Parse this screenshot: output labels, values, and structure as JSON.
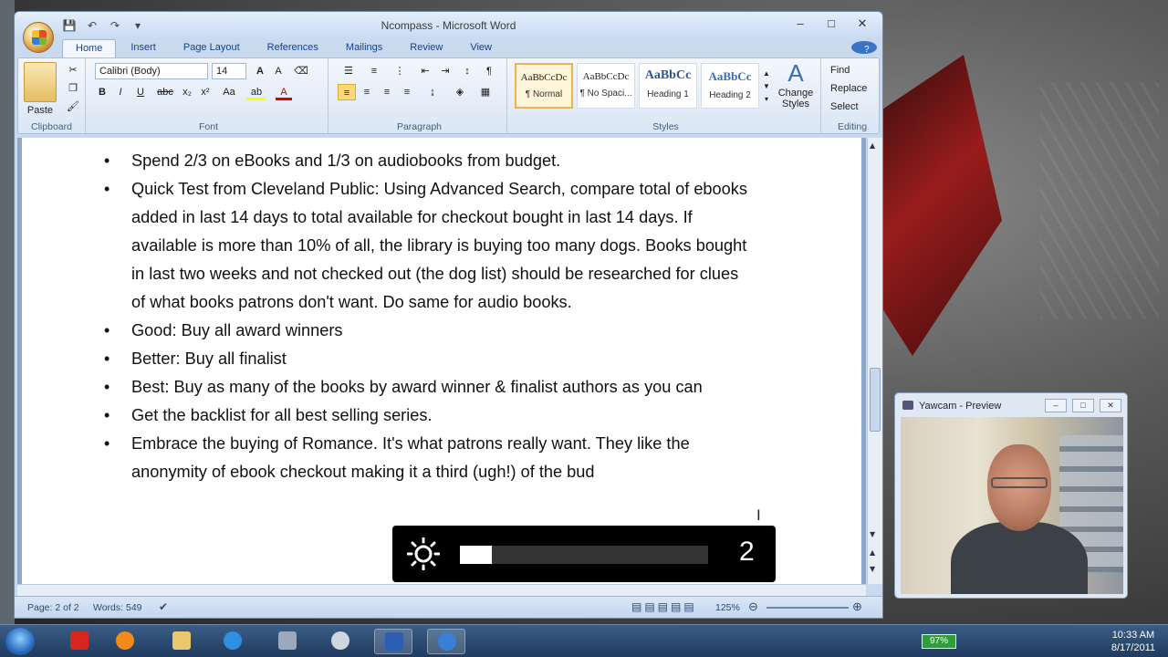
{
  "window": {
    "title": "Ncompass - Microsoft Word",
    "controls": [
      "–",
      "□",
      "✕"
    ]
  },
  "tabs": [
    "Home",
    "Insert",
    "Page Layout",
    "References",
    "Mailings",
    "Review",
    "View"
  ],
  "ribbon": {
    "clipboard": {
      "label": "Clipboard",
      "paste": "Paste"
    },
    "font": {
      "label": "Font",
      "family": "Calibri (Body)",
      "size": "14"
    },
    "paragraph": {
      "label": "Paragraph"
    },
    "styles": {
      "label": "Styles",
      "items": [
        {
          "preview": "AaBbCcDc",
          "name": "¶ Normal"
        },
        {
          "preview": "AaBbCcDc",
          "name": "¶ No Spaci..."
        },
        {
          "preview": "AaBbCc",
          "name": "Heading 1"
        },
        {
          "preview": "AaBbCc",
          "name": "Heading 2"
        }
      ],
      "change": "Change Styles"
    },
    "editing": {
      "label": "Editing",
      "find": "Find",
      "replace": "Replace",
      "select": "Select"
    }
  },
  "document": {
    "bullets": [
      "Spend 2/3 on eBooks and 1/3 on audiobooks from budget.",
      "Quick Test from Cleveland Public: Using Advanced Search, compare total of ebooks added in last 14 days to total available for checkout bought in last 14 days. If available is more than 10% of all, the library is buying too many dogs. Books bought in last two weeks and not checked out (the dog list) should be researched for clues of what books patrons don't want. Do same for audio books.",
      "Good: Buy all award winners",
      "Better: Buy all finalist",
      "Best: Buy as many of the books by award winner & finalist authors as you can",
      "Get the backlist for all best selling series.",
      "Embrace the buying of Romance. It's what patrons really want. They like the anonymity of ebook checkout making it a third (ugh!) of the bud"
    ]
  },
  "status": {
    "page": "Page: 2 of 2",
    "words": "Words: 549",
    "zoom": "125%"
  },
  "osd": {
    "value": "2",
    "level_fraction": 0.13
  },
  "yawcam": {
    "title": "Yawcam - Preview"
  },
  "tray": {
    "battery": "97%",
    "time": "10:33 AM",
    "date": "8/17/2011"
  }
}
